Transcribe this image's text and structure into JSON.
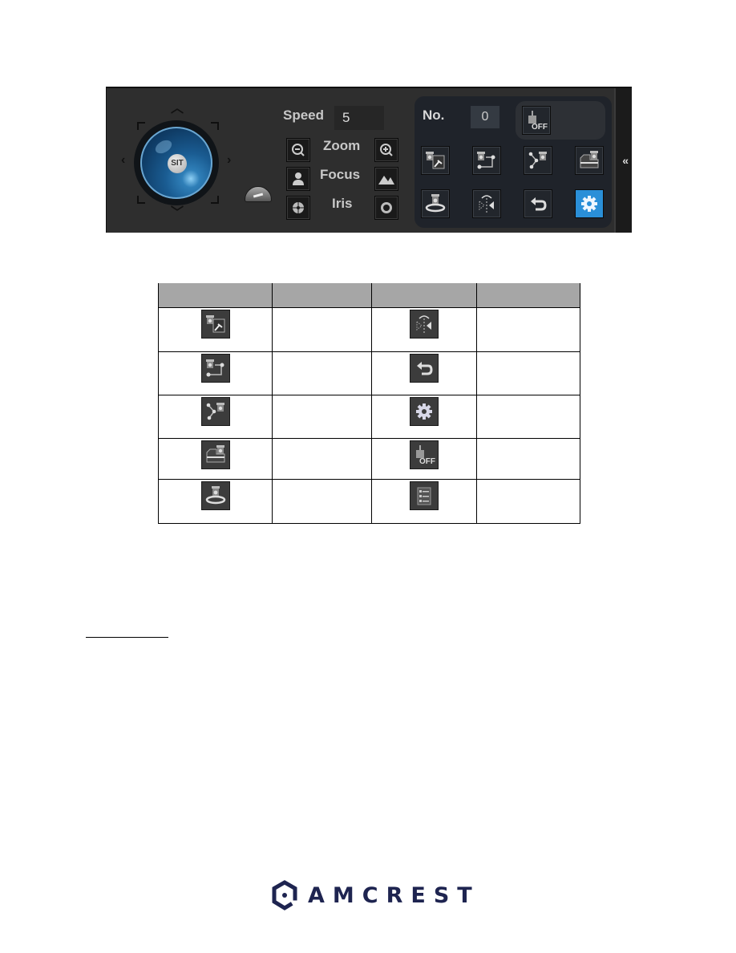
{
  "ptz_panel": {
    "joystick": {
      "center_label": "SIT"
    },
    "speed": {
      "label": "Speed",
      "value": "5"
    },
    "controls": [
      {
        "label": "Zoom",
        "minus_icon": "zoom-out-icon",
        "plus_icon": "zoom-in-icon"
      },
      {
        "label": "Focus",
        "minus_icon": "focus-near-icon",
        "plus_icon": "focus-far-icon"
      },
      {
        "label": "Iris",
        "minus_icon": "iris-close-icon",
        "plus_icon": "iris-open-icon"
      }
    ],
    "preset": {
      "label": "No.",
      "value": "0"
    },
    "wiper_label": "OFF",
    "function_buttons": [
      {
        "name": "preset",
        "icon": "preset-icon"
      },
      {
        "name": "tour",
        "icon": "tour-icon"
      },
      {
        "name": "pattern",
        "icon": "pattern-icon"
      },
      {
        "name": "scan",
        "icon": "scan-icon"
      },
      {
        "name": "rotate",
        "icon": "rotate-icon"
      },
      {
        "name": "flip",
        "icon": "flip-icon"
      },
      {
        "name": "reset",
        "icon": "reset-icon"
      },
      {
        "name": "settings",
        "icon": "gear-icon",
        "active": true
      }
    ],
    "collapse_glyph": "«",
    "active_color": "#2a8fd8"
  },
  "table": {
    "headers": [
      "",
      "",
      "",
      ""
    ],
    "rows": [
      {
        "left_icon": "preset-icon",
        "left_text": "",
        "right_icon": "flip-icon",
        "right_text": ""
      },
      {
        "left_icon": "tour-icon",
        "left_text": "",
        "right_icon": "reset-icon",
        "right_text": ""
      },
      {
        "left_icon": "pattern-icon",
        "left_text": "",
        "right_icon": "gear-icon",
        "right_text": ""
      },
      {
        "left_icon": "scan-icon",
        "left_text": "",
        "right_icon": "wiper-icon",
        "right_text": ""
      },
      {
        "left_icon": "rotate-icon",
        "left_text": "",
        "right_icon": "menu-list-icon",
        "right_text": ""
      }
    ],
    "wiper_text": "OFF"
  },
  "footer": {
    "brand": "AMCREST",
    "brand_color": "#1e2450"
  }
}
